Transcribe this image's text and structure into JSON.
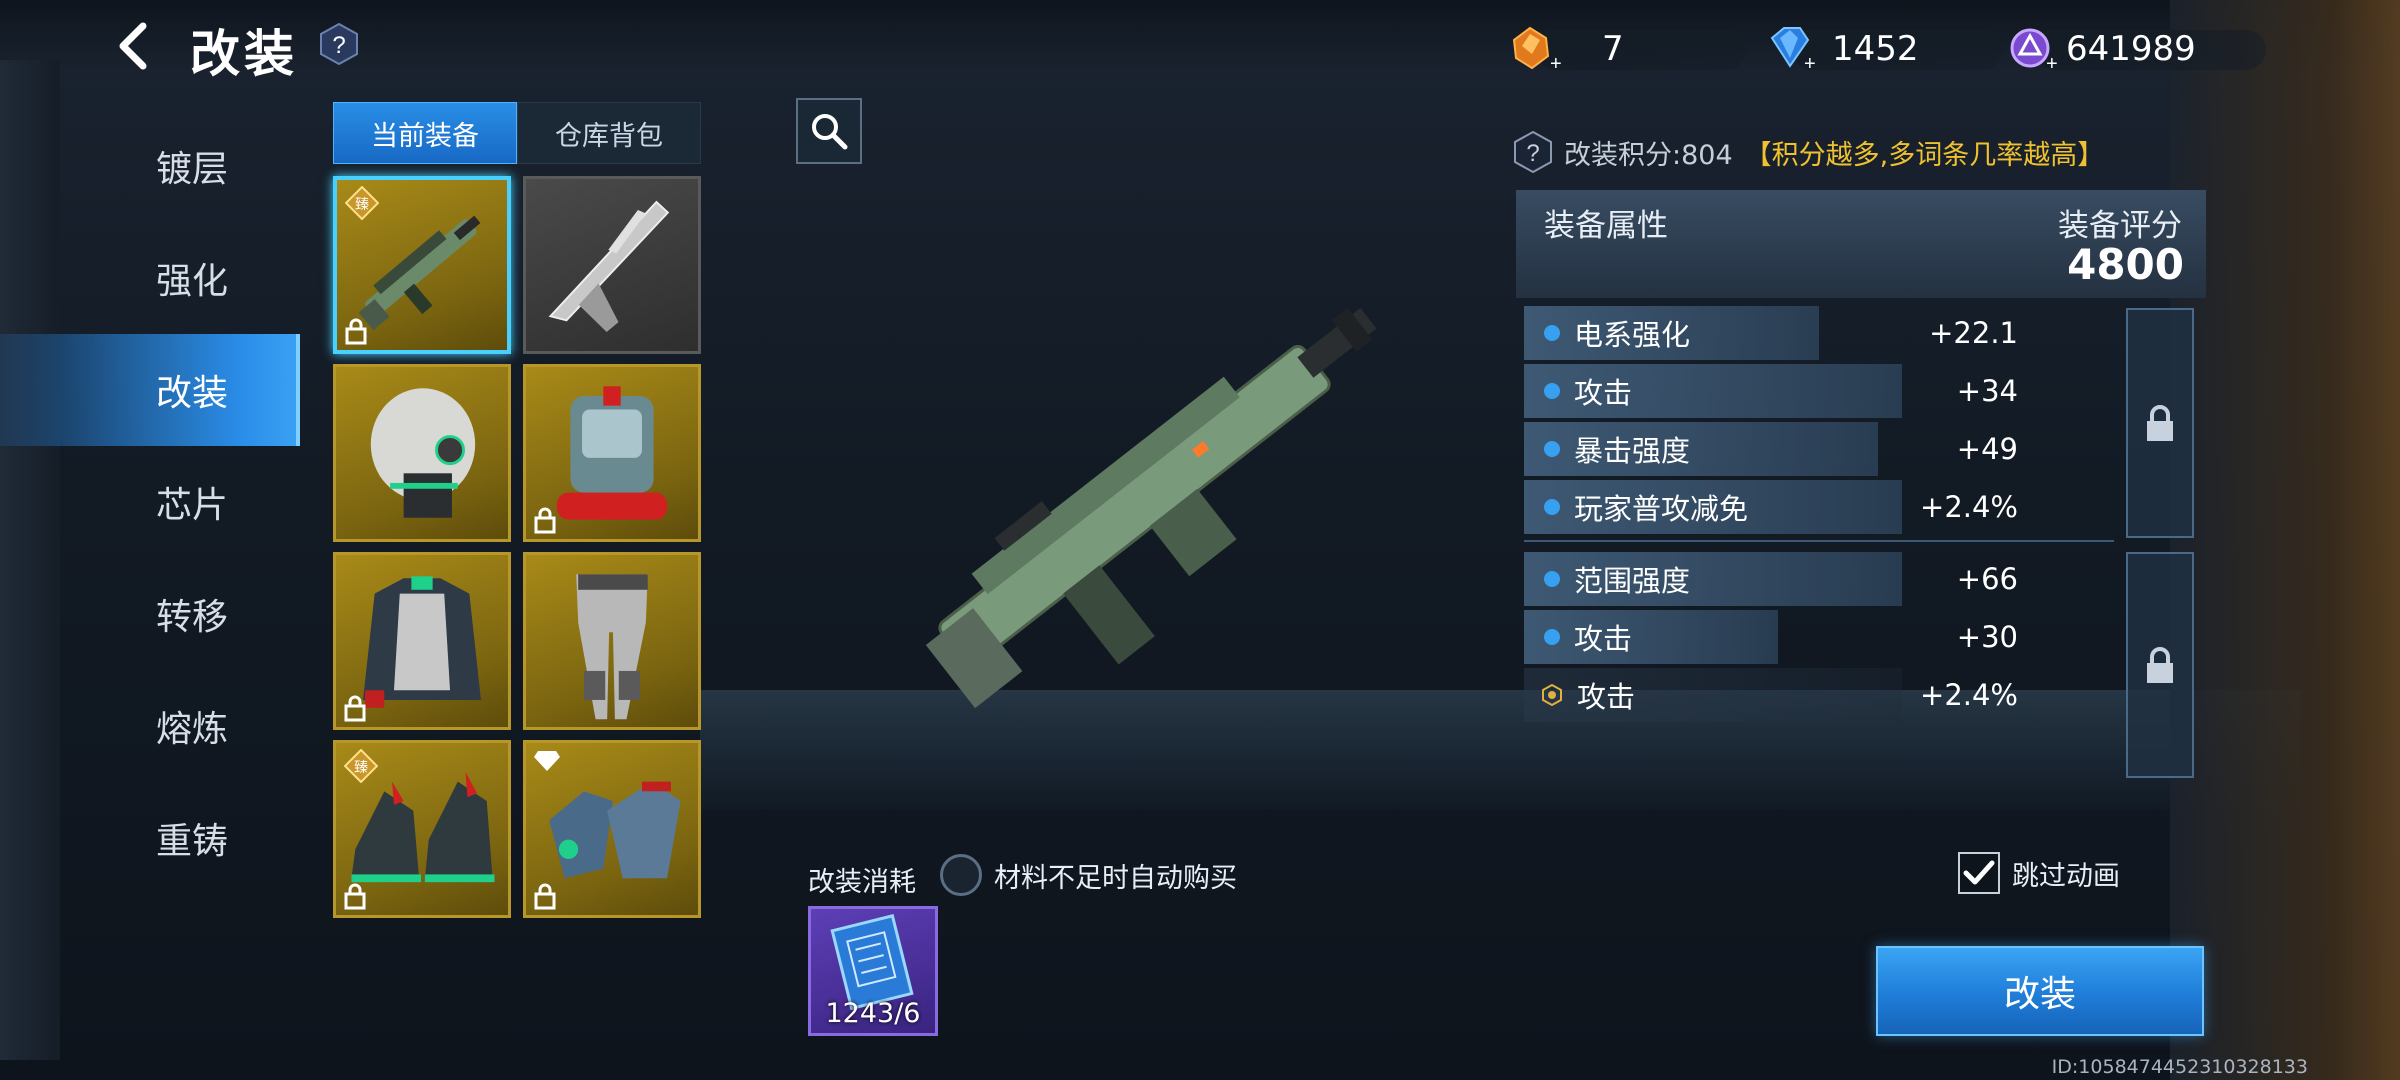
{
  "header": {
    "title": "改装",
    "back_icon": "back-arrow-icon",
    "help_icon": "question-icon"
  },
  "currencies": [
    {
      "icon": "orange-crystal-icon",
      "value": "7"
    },
    {
      "icon": "blue-diamond-icon",
      "value": "1452"
    },
    {
      "icon": "purple-coin-icon",
      "value": "641989"
    }
  ],
  "menu": {
    "items": [
      {
        "label": "镀层",
        "active": false
      },
      {
        "label": "强化",
        "active": false
      },
      {
        "label": "改装",
        "active": true
      },
      {
        "label": "芯片",
        "active": false
      },
      {
        "label": "转移",
        "active": false
      },
      {
        "label": "熔炼",
        "active": false
      },
      {
        "label": "重铸",
        "active": false
      }
    ]
  },
  "equipment": {
    "tabs": [
      {
        "label": "当前装备",
        "active": true
      },
      {
        "label": "仓库背包",
        "active": false
      }
    ],
    "slots": [
      {
        "item": "rifle",
        "selected": true
      },
      {
        "item": "silver-blade-weapon",
        "selected": false
      },
      {
        "item": "helmet",
        "selected": false
      },
      {
        "item": "backpack",
        "selected": false
      },
      {
        "item": "armor-jacket",
        "selected": false
      },
      {
        "item": "leg-armor",
        "selected": false
      },
      {
        "item": "boots",
        "selected": false
      },
      {
        "item": "gloves",
        "selected": false
      }
    ]
  },
  "score": {
    "label": "改装积分:804",
    "hint": "【积分越多,多词条几率越高】"
  },
  "attributes": {
    "title": "装备属性",
    "rating_title": "装备评分",
    "rating_value": "4800",
    "group1": [
      {
        "name": "电系强化",
        "value": "+22.1",
        "fill": 0.5
      },
      {
        "name": "攻击",
        "value": "+34",
        "fill": 0.64
      },
      {
        "name": "暴击强度",
        "value": "+49",
        "fill": 0.6
      },
      {
        "name": "玩家普攻减免",
        "value": "+2.4%",
        "fill": 0.64
      }
    ],
    "group2": [
      {
        "name": "范围强度",
        "value": "+66",
        "fill": 0.64
      },
      {
        "name": "攻击",
        "value": "+30",
        "fill": 0.43
      },
      {
        "name": "攻击",
        "value": "+2.4%",
        "fill": 0.64,
        "special": true
      }
    ]
  },
  "bottom": {
    "cost_label": "改装消耗",
    "auto_buy_label": "材料不足时自动购买",
    "material_count": "1243/6",
    "skip_label": "跳过动画",
    "skip_checked": true,
    "modify_button": "改装",
    "player_id": "ID:1058474452310328133"
  },
  "colors": {
    "accent_blue": "#2a8de8",
    "gold_hint": "#f0c230",
    "slot_gold": "#a88a18"
  }
}
